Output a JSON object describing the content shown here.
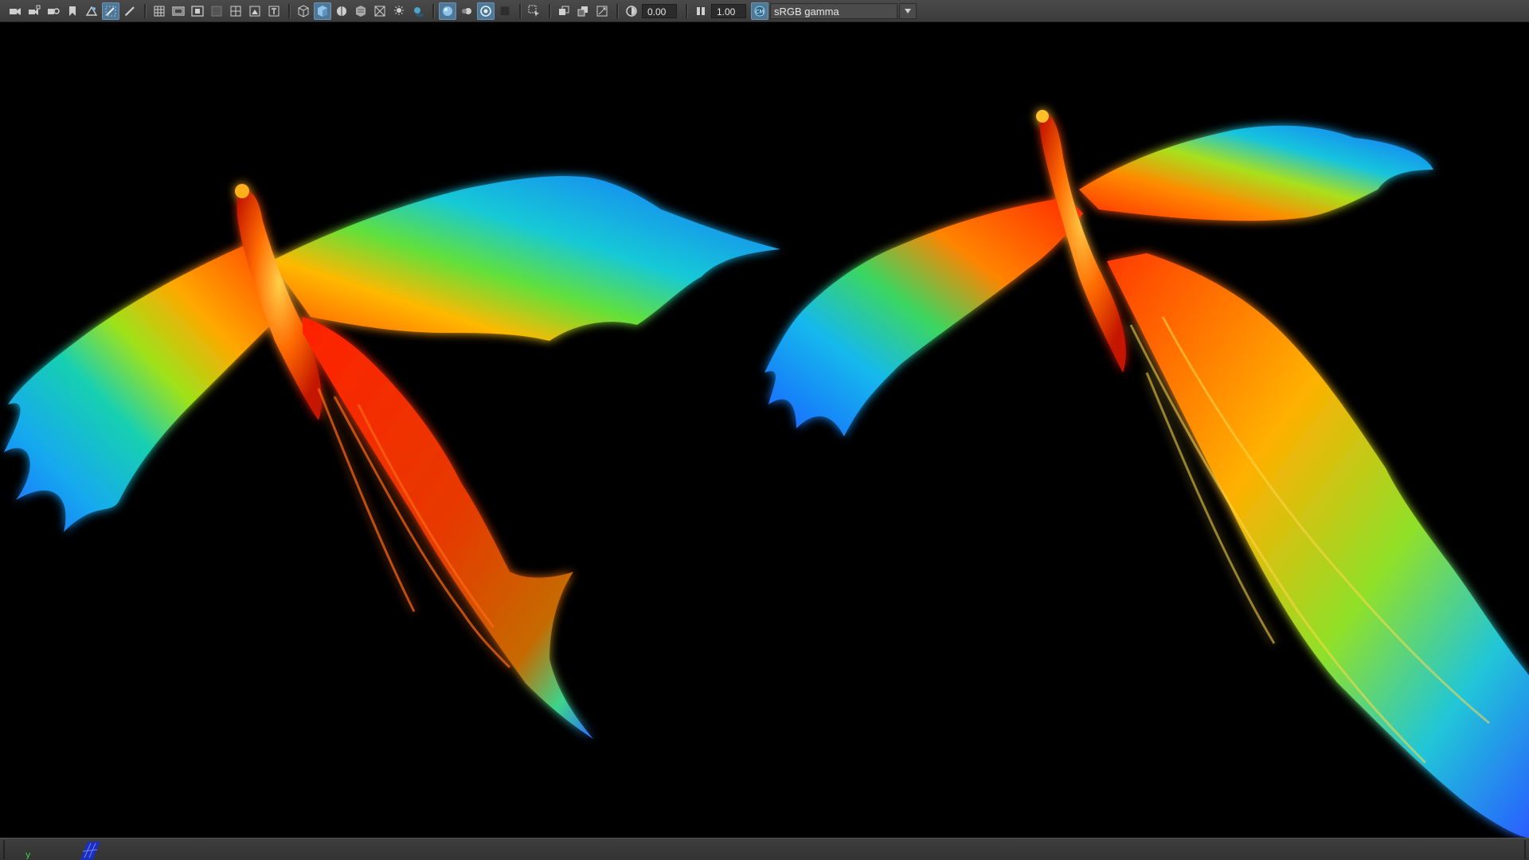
{
  "toolbar": {
    "exposure_value": "0.00",
    "gamma_value": "1.00",
    "color_space": "sRGB gamma",
    "icons": [
      "camera-icon",
      "camera-lock-icon",
      "camera-attributes-icon",
      "bookmark-icon",
      "image-plane-icon",
      "grease-pencil-icon",
      "grid-icon",
      "film-gate-icon",
      "resolution-gate-icon",
      "gate-mask-icon",
      "field-chart-icon",
      "safe-action-icon",
      "safe-title-icon",
      "wireframe-icon",
      "smooth-shade-icon",
      "shaded-wireframe-icon",
      "textured-icon",
      "xray-icon",
      "lighting-icon",
      "shadows-icon",
      "ambient-occlusion-icon",
      "motion-blur-icon",
      "anti-alias-icon",
      "depth-of-field-icon",
      "isolate-select-icon",
      "xray-joints-icon",
      "xray-active-icon",
      "backface-icon",
      "exposure-icon",
      "gamma-icon",
      "color-management-icon",
      "chevron-down-icon"
    ]
  },
  "viewport": {
    "background_color": "#000000",
    "wing_colors": [
      "#ff2a00",
      "#ff8a00",
      "#ffd200",
      "#34d93a",
      "#12b4e8",
      "#1a6cff"
    ]
  },
  "statusbar": {
    "axis_label": "y"
  }
}
